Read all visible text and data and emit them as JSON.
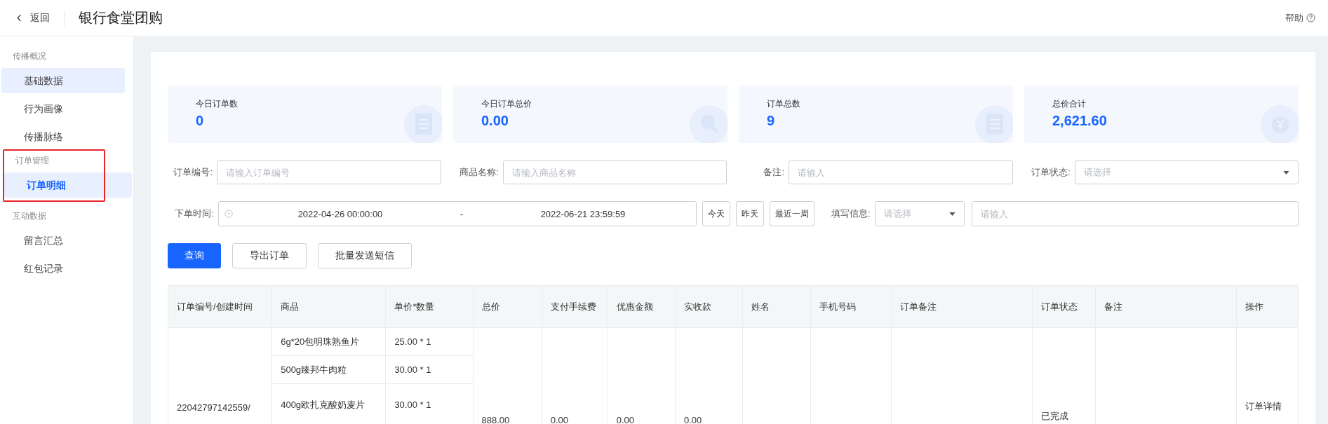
{
  "header": {
    "back": "返回",
    "title": "银行食堂团购",
    "help": "帮助"
  },
  "sidebar": [
    {
      "title": "传播概况",
      "annotated": false,
      "items": [
        {
          "label": "基础数据",
          "selected": false,
          "hovered": true
        },
        {
          "label": "行为画像",
          "selected": false,
          "hovered": false
        },
        {
          "label": "传播脉络",
          "selected": false,
          "hovered": false
        }
      ]
    },
    {
      "title": "订单管理",
      "annotated": true,
      "items": [
        {
          "label": "订单明细",
          "selected": true,
          "hovered": true
        }
      ]
    },
    {
      "title": "互动数据",
      "annotated": false,
      "items": [
        {
          "label": "留言汇总",
          "selected": false,
          "hovered": false
        },
        {
          "label": "红包记录",
          "selected": false,
          "hovered": false
        }
      ]
    }
  ],
  "stats": [
    {
      "label": "今日订单数",
      "value": "0"
    },
    {
      "label": "今日订单总价",
      "value": "0.00"
    },
    {
      "label": "订单总数",
      "value": "9"
    },
    {
      "label": "总价合计",
      "value": "2,621.60"
    }
  ],
  "filters": [
    {
      "label": "订单编号:",
      "kind": "text",
      "placeholder": "请输入订单编号"
    },
    {
      "label": "商品名称:",
      "kind": "text",
      "placeholder": "请输入商品名称"
    },
    {
      "label": "备注:",
      "kind": "text",
      "placeholder": "请输入"
    },
    {
      "label": "订单状态:",
      "kind": "select",
      "placeholder": "请选择"
    }
  ],
  "date_filter": {
    "label": "下单时间:",
    "start": "2022-04-26 00:00:00",
    "separator": "-",
    "end": "2022-06-21 23:59:59",
    "quick": [
      "今天",
      "昨天",
      "最近一周"
    ]
  },
  "fill_info": {
    "label": "填写信息:",
    "select_placeholder": "请选择",
    "input_placeholder": "请输入"
  },
  "actions": [
    {
      "label": "查询",
      "primary": true
    },
    {
      "label": "导出订单",
      "primary": false
    },
    {
      "label": "批量发送短信",
      "primary": false
    }
  ],
  "table": {
    "columns": [
      "订单编号/创建时间",
      "商品",
      "单价*数量",
      "总价",
      "支付手续费",
      "优惠金额",
      "实收款",
      "姓名",
      "手机号码",
      "订单备注",
      "订单状态",
      "备注",
      "操作"
    ],
    "order": {
      "order_no": "22042797142559/",
      "items": [
        {
          "name": "6g*20包明珠熟鱼片",
          "price": "25.00 * 1"
        },
        {
          "name": "500g臻邦牛肉粒",
          "price": "30.00 * 1"
        },
        {
          "name": "400g欧扎克酸奶麦片",
          "price": "30.00 * 1"
        }
      ],
      "total": "888.00",
      "fee": "0.00",
      "discount": "0.00",
      "received": "0.00",
      "status": "已完成",
      "action": "订单详情"
    }
  }
}
